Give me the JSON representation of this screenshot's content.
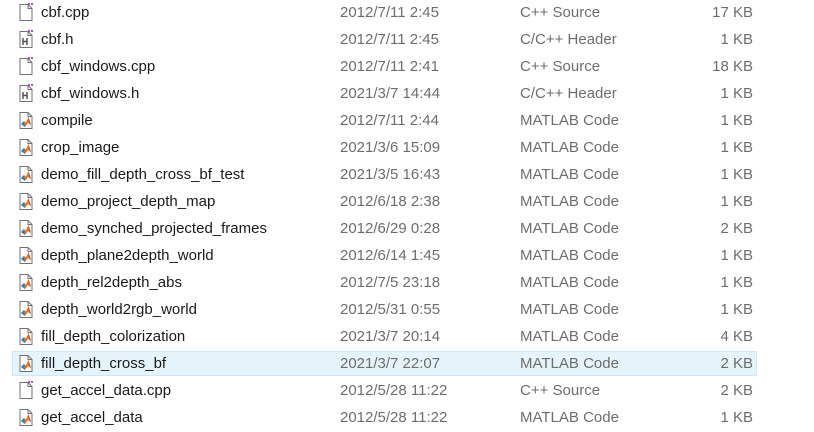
{
  "files": [
    {
      "name": "cbf.cpp",
      "date": "2012/7/11 2:45",
      "type": "C++ Source",
      "size": "17 KB",
      "icon": "cpp-file-icon"
    },
    {
      "name": "cbf.h",
      "date": "2012/7/11 2:45",
      "type": "C/C++ Header",
      "size": "1 KB",
      "icon": "header-file-icon"
    },
    {
      "name": "cbf_windows.cpp",
      "date": "2012/7/11 2:41",
      "type": "C++ Source",
      "size": "18 KB",
      "icon": "cpp-file-icon"
    },
    {
      "name": "cbf_windows.h",
      "date": "2021/3/7 14:44",
      "type": "C/C++ Header",
      "size": "1 KB",
      "icon": "header-file-icon"
    },
    {
      "name": "compile",
      "date": "2012/7/11 2:44",
      "type": "MATLAB Code",
      "size": "1 KB",
      "icon": "matlab-file-icon"
    },
    {
      "name": "crop_image",
      "date": "2021/3/6 15:09",
      "type": "MATLAB Code",
      "size": "1 KB",
      "icon": "matlab-file-icon"
    },
    {
      "name": "demo_fill_depth_cross_bf_test",
      "date": "2021/3/5 16:43",
      "type": "MATLAB Code",
      "size": "1 KB",
      "icon": "matlab-file-icon"
    },
    {
      "name": "demo_project_depth_map",
      "date": "2012/6/18 2:38",
      "type": "MATLAB Code",
      "size": "1 KB",
      "icon": "matlab-file-icon"
    },
    {
      "name": "demo_synched_projected_frames",
      "date": "2012/6/29 0:28",
      "type": "MATLAB Code",
      "size": "2 KB",
      "icon": "matlab-file-icon"
    },
    {
      "name": "depth_plane2depth_world",
      "date": "2012/6/14 1:45",
      "type": "MATLAB Code",
      "size": "1 KB",
      "icon": "matlab-file-icon"
    },
    {
      "name": "depth_rel2depth_abs",
      "date": "2012/7/5 23:18",
      "type": "MATLAB Code",
      "size": "1 KB",
      "icon": "matlab-file-icon"
    },
    {
      "name": "depth_world2rgb_world",
      "date": "2012/5/31 0:55",
      "type": "MATLAB Code",
      "size": "1 KB",
      "icon": "matlab-file-icon"
    },
    {
      "name": "fill_depth_colorization",
      "date": "2021/3/7 20:14",
      "type": "MATLAB Code",
      "size": "4 KB",
      "icon": "matlab-file-icon"
    },
    {
      "name": "fill_depth_cross_bf",
      "date": "2021/3/7 22:07",
      "type": "MATLAB Code",
      "size": "2 KB",
      "icon": "matlab-file-icon",
      "selected": true
    },
    {
      "name": "get_accel_data.cpp",
      "date": "2012/5/28 11:22",
      "type": "C++ Source",
      "size": "2 KB",
      "icon": "cpp-file-icon"
    },
    {
      "name": "get_accel_data",
      "date": "2012/5/28 11:22",
      "type": "MATLAB Code",
      "size": "1 KB",
      "icon": "matlab-file-icon"
    }
  ],
  "colors": {
    "selection_bg": "#e5f3fb",
    "selection_border": "#cde8f8",
    "secondary_text": "#6d6d6d"
  }
}
